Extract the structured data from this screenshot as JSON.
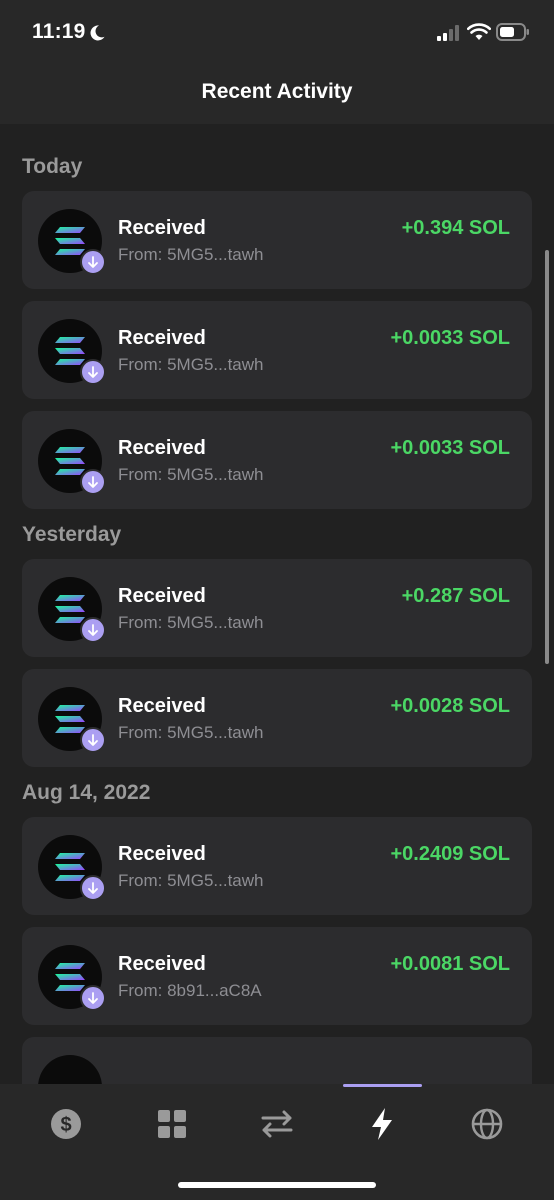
{
  "status_bar": {
    "time": "11:19"
  },
  "header": {
    "title": "Recent Activity"
  },
  "sections": [
    {
      "title": "Today",
      "items": [
        {
          "title": "Received",
          "from": "From: 5MG5...tawh",
          "amount": "+0.394 SOL"
        },
        {
          "title": "Received",
          "from": "From: 5MG5...tawh",
          "amount": "+0.0033 SOL"
        },
        {
          "title": "Received",
          "from": "From: 5MG5...tawh",
          "amount": "+0.0033 SOL"
        }
      ]
    },
    {
      "title": "Yesterday",
      "items": [
        {
          "title": "Received",
          "from": "From: 5MG5...tawh",
          "amount": "+0.287 SOL"
        },
        {
          "title": "Received",
          "from": "From: 5MG5...tawh",
          "amount": "+0.0028 SOL"
        }
      ]
    },
    {
      "title": "Aug 14, 2022",
      "items": [
        {
          "title": "Received",
          "from": "From: 5MG5...tawh",
          "amount": "+0.2409 SOL"
        },
        {
          "title": "Received",
          "from": "From: 8b91...aC8A",
          "amount": "+0.0081 SOL"
        }
      ]
    }
  ],
  "tabbar": {
    "tabs": [
      {
        "icon": "dollar-icon",
        "active": false
      },
      {
        "icon": "grid-icon",
        "active": false
      },
      {
        "icon": "swap-icon",
        "active": false
      },
      {
        "icon": "lightning-icon",
        "active": true
      },
      {
        "icon": "globe-icon",
        "active": false
      }
    ]
  },
  "colors": {
    "background": "#212121",
    "card": "#2c2c2e",
    "positive": "#4bd765",
    "accent": "#ab9ff2",
    "muted": "#8e8e93"
  }
}
